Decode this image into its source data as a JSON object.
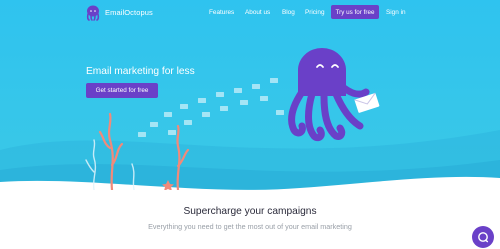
{
  "brand": {
    "name": "EmailOctopus"
  },
  "nav": {
    "links": [
      "Features",
      "About us",
      "Blog",
      "Pricing"
    ],
    "cta_label": "Try us for free",
    "signin_label": "Sign in"
  },
  "hero": {
    "headline": "Email marketing for less",
    "cta_label": "Get started for free"
  },
  "section": {
    "title": "Supercharge your campaigns",
    "subtitle": "Everything you need to get the most out of your email marketing"
  },
  "icons": {
    "logo": "octopus-logo-icon",
    "mascot": "octopus-mascot-icon",
    "chat": "chat-icon"
  },
  "colors": {
    "hero_bg": "#34c5ec",
    "accent": "#6a40c8",
    "heading": "#2a2a3a",
    "muted": "#9aa0a8"
  }
}
